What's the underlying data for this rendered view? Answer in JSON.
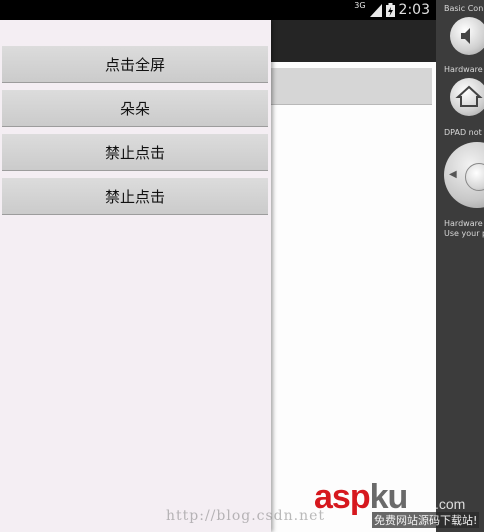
{
  "status_bar": {
    "network_label": "3G",
    "time": "2:03"
  },
  "drawer": {
    "buttons": [
      {
        "label": "点击全屏"
      },
      {
        "label": "朵朵"
      },
      {
        "label": "禁止点击"
      },
      {
        "label": "禁止点击"
      }
    ]
  },
  "emulator_panel": {
    "basic_controls_label": "Basic Con",
    "hardware_label_1": "Hardware",
    "dpad_label": "DPAD not",
    "hardware_label_2": "Hardware",
    "use_your_label": "Use your p",
    "icons": [
      "volume-icon",
      "home-icon",
      "dpad-control"
    ]
  },
  "watermark": {
    "url": "http://blog.csdn.net",
    "brand_asp": "asp",
    "brand_ku": "ku",
    "brand_com": ".com",
    "tagline": "免费网站源码下载站!"
  },
  "colors": {
    "status_bar": "#000000",
    "action_bar": "#252525",
    "drawer_bg": "#f4eef3",
    "button_bg": "#d4d4d4",
    "panel_bg": "#3c3c3c",
    "brand_red": "#d6181e"
  }
}
